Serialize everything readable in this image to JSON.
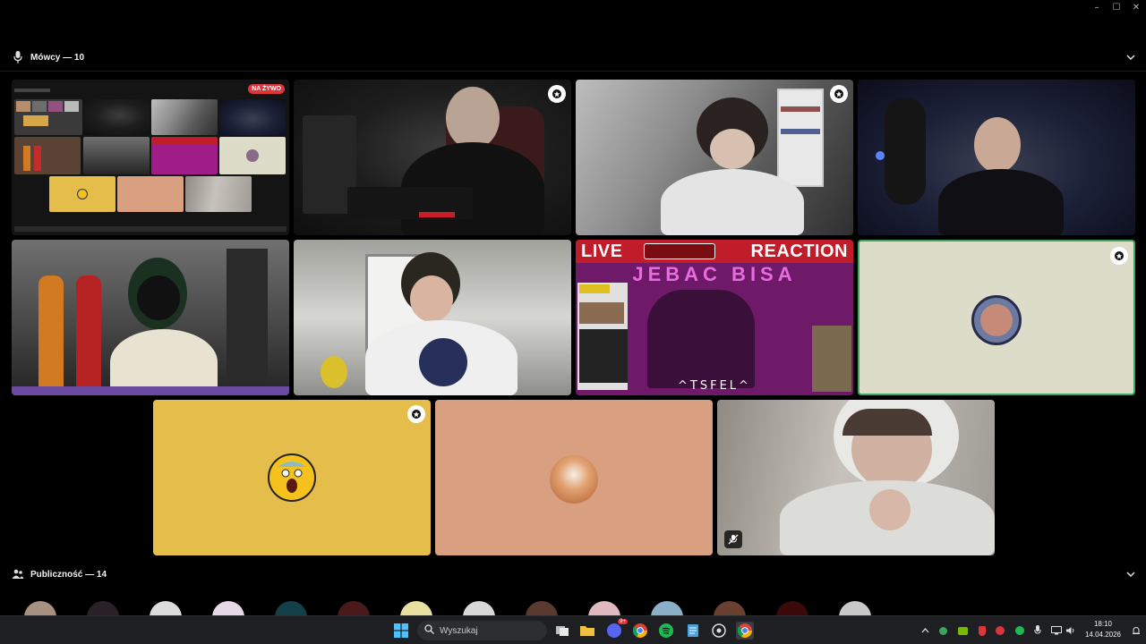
{
  "window": {
    "controls": [
      "–",
      "☐",
      "✕"
    ]
  },
  "speakers": {
    "label": "Mówcy — 10"
  },
  "audience": {
    "label": "Publiczność — 14"
  },
  "stage": {
    "live_badge": "NA ŻYWO",
    "live_reaction": {
      "left": "LIVE",
      "right": "REACTION",
      "subtitle": "JEBAC BISA",
      "footer": "^TSFEL^"
    }
  },
  "taskbar": {
    "search_placeholder": "Wyszukaj",
    "time": "18:10",
    "date": "14.04.2026",
    "discord_badge": "9+"
  },
  "colors": {
    "accent_green": "#3ba55d",
    "live_red": "#da373c",
    "yellow_tile": "#e5bd4a",
    "peach_tile": "#d8a080",
    "cream_tile": "#dcdcc8"
  }
}
